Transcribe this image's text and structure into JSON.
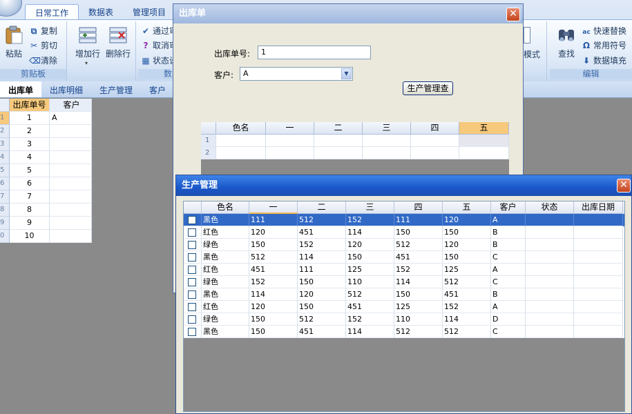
{
  "ribbon": {
    "tabs": [
      "日常工作",
      "数据表",
      "管理项目"
    ],
    "groups": {
      "clipboard": {
        "label": "剪贴板",
        "paste": "粘贴",
        "copy": "复制",
        "cut": "剪切",
        "clear": "清除"
      },
      "rows": {
        "add": "增加行",
        "delete": "删除行"
      },
      "data": {
        "approve": "通过审",
        "cancel": "取消审",
        "status": "状态设",
        "label": "数"
      },
      "mode": {
        "label": "模式"
      },
      "edit": {
        "label": "编辑",
        "find": "查找",
        "replace": "快速替换",
        "symbols": "常用符号",
        "fill": "数据填充"
      }
    }
  },
  "doctabs": [
    "出库单",
    "出库明细",
    "生产管理",
    "客户"
  ],
  "left_grid": {
    "headers": [
      "出库单号",
      "客户"
    ],
    "rows": [
      {
        "rh": "1",
        "no": "1",
        "customer": "A"
      },
      {
        "rh": "2",
        "no": "2",
        "customer": ""
      },
      {
        "rh": "3",
        "no": "3",
        "customer": ""
      },
      {
        "rh": "4",
        "no": "4",
        "customer": ""
      },
      {
        "rh": "5",
        "no": "5",
        "customer": ""
      },
      {
        "rh": "6",
        "no": "6",
        "customer": ""
      },
      {
        "rh": "7",
        "no": "7",
        "customer": ""
      },
      {
        "rh": "8",
        "no": "8",
        "customer": ""
      },
      {
        "rh": "9",
        "no": "9",
        "customer": ""
      },
      {
        "rh": "0",
        "no": "10",
        "customer": ""
      }
    ]
  },
  "dialog_order": {
    "title": "出库单",
    "order_no_label": "出库单号:",
    "order_no_value": "1",
    "customer_label": "客户:",
    "customer_value": "A",
    "query_button": "生产管理查",
    "grid_headers": [
      "色名",
      "一",
      "二",
      "三",
      "四",
      "五"
    ],
    "row_numbers": [
      "1",
      "2"
    ]
  },
  "dialog_production": {
    "title": "生产管理",
    "headers": [
      "色名",
      "一",
      "二",
      "三",
      "四",
      "五",
      "客户",
      "状态",
      "出库日期"
    ],
    "rows": [
      [
        "黑色",
        "111",
        "512",
        "152",
        "111",
        "120",
        "A",
        "",
        ""
      ],
      [
        "红色",
        "120",
        "451",
        "114",
        "150",
        "150",
        "B",
        "",
        ""
      ],
      [
        "绿色",
        "150",
        "152",
        "120",
        "512",
        "120",
        "B",
        "",
        ""
      ],
      [
        "黑色",
        "512",
        "114",
        "150",
        "451",
        "150",
        "C",
        "",
        ""
      ],
      [
        "红色",
        "451",
        "111",
        "125",
        "152",
        "125",
        "A",
        "",
        ""
      ],
      [
        "绿色",
        "152",
        "150",
        "110",
        "114",
        "512",
        "C",
        "",
        ""
      ],
      [
        "黑色",
        "114",
        "120",
        "512",
        "150",
        "451",
        "B",
        "",
        ""
      ],
      [
        "红色",
        "120",
        "150",
        "451",
        "125",
        "152",
        "A",
        "",
        ""
      ],
      [
        "绿色",
        "150",
        "512",
        "152",
        "110",
        "114",
        "D",
        "",
        ""
      ],
      [
        "黑色",
        "150",
        "451",
        "114",
        "512",
        "512",
        "C",
        "",
        ""
      ]
    ],
    "selected_row": 0
  }
}
